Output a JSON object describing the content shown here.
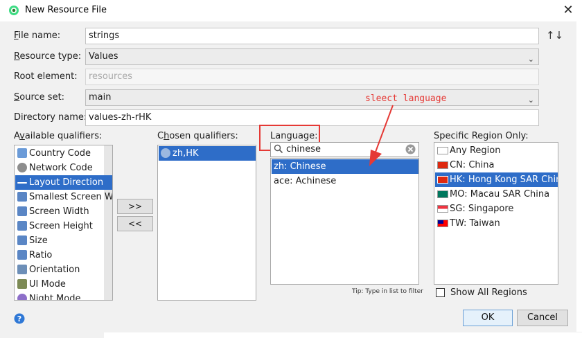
{
  "window": {
    "title": "New Resource File"
  },
  "form": {
    "file_name_label": "ile name:",
    "file_name_mnemonic": "F",
    "file_name_value": "strings",
    "resource_type_label": "esource type:",
    "resource_type_mnemonic": "R",
    "resource_type_value": "Values",
    "root_element_label": "Root element:",
    "root_element_mnemonic": "e",
    "root_element_placeholder": "resources",
    "source_set_label": "ource set:",
    "source_set_mnemonic": "S",
    "source_set_value": "main",
    "directory_name_label": "Directory name:",
    "directory_name_value": "values-zh-rHK",
    "sort_icon": "↑↓"
  },
  "available": {
    "label_pre": "A",
    "label_u": "v",
    "label_post": "ailable qualifiers:",
    "items": [
      {
        "label": "Country Code",
        "icon": "globe-icon"
      },
      {
        "label": "Network Code",
        "icon": "network-icon"
      },
      {
        "label": "Layout Direction",
        "icon": "layout-direction-icon"
      },
      {
        "label": "Smallest Screen W",
        "icon": "smallest-screen-icon"
      },
      {
        "label": "Screen Width",
        "icon": "screen-width-icon"
      },
      {
        "label": "Screen Height",
        "icon": "screen-height-icon"
      },
      {
        "label": "Size",
        "icon": "size-icon"
      },
      {
        "label": "Ratio",
        "icon": "ratio-icon"
      },
      {
        "label": "Orientation",
        "icon": "orientation-icon"
      },
      {
        "label": "UI Mode",
        "icon": "ui-mode-icon"
      },
      {
        "label": "Night Mode",
        "icon": "night-mode-icon"
      }
    ],
    "selected_index": 2
  },
  "buttons": {
    "add": ">>",
    "remove": "<<",
    "ok": "OK",
    "cancel": "Cancel"
  },
  "chosen": {
    "label_pre": "C",
    "label_u": "h",
    "label_post": "osen qualifiers:",
    "items": [
      {
        "label": "zh,HK",
        "icon": "globe-icon"
      }
    ]
  },
  "language": {
    "label": "Language:",
    "search_value": "chinese",
    "items": [
      {
        "label": "zh: Chinese",
        "selected": true
      },
      {
        "label": "ace: Achinese",
        "selected": false
      }
    ],
    "tip": "Tip: Type in list to filter"
  },
  "region": {
    "label": "Specific Region Only:",
    "items": [
      {
        "label": "Any Region",
        "flag": "blank"
      },
      {
        "label": "CN: China",
        "flag": "cn"
      },
      {
        "label": "HK: Hong Kong SAR China",
        "flag": "hk"
      },
      {
        "label": "MO: Macau SAR China",
        "flag": "mo"
      },
      {
        "label": "SG: Singapore",
        "flag": "sg"
      },
      {
        "label": "TW: Taiwan",
        "flag": "tw"
      }
    ],
    "selected_index": 2,
    "show_all_label": "Show All Regions",
    "show_all_checked": false
  },
  "annotation": {
    "text": "sleect language",
    "color": "#e53935"
  },
  "colors": {
    "selection": "#2e6dc8",
    "accent": "#e53935"
  }
}
